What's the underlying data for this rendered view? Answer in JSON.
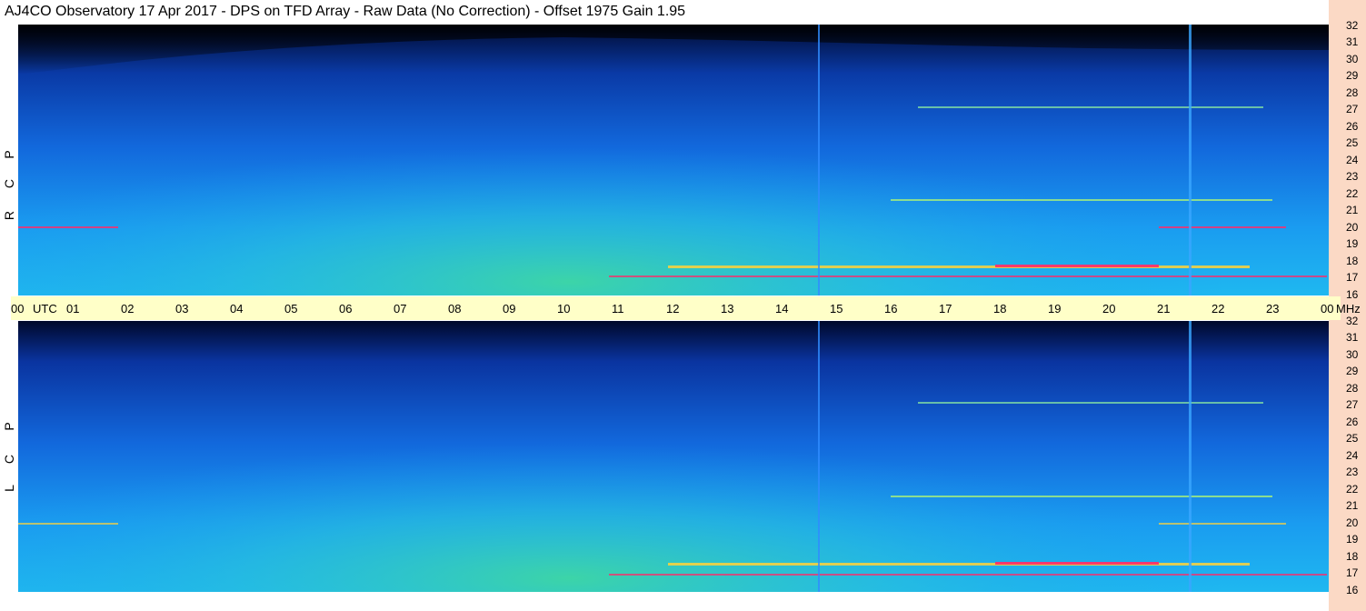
{
  "header": {
    "title": "AJ4CO Observatory  17 Apr 2017  -  DPS on TFD Array  -  Raw Data (No Correction)  -  Offset 1975  Gain 1.95"
  },
  "polarizations": {
    "top": [
      "R",
      "C",
      "P"
    ],
    "bottom": [
      "L",
      "C",
      "P"
    ]
  },
  "time_axis": {
    "labels": [
      "00",
      "01",
      "02",
      "03",
      "04",
      "05",
      "06",
      "07",
      "08",
      "09",
      "10",
      "11",
      "12",
      "13",
      "14",
      "15",
      "16",
      "17",
      "18",
      "19",
      "20",
      "21",
      "22",
      "23",
      "00"
    ],
    "utc_label": "UTC",
    "mhz_label": "MHz"
  },
  "freq_axis": {
    "labels": [
      "32",
      "31",
      "30",
      "29",
      "28",
      "27",
      "26",
      "25",
      "24",
      "23",
      "22",
      "21",
      "20",
      "19",
      "18",
      "17",
      "16"
    ]
  },
  "colors": {
    "background": "#ffffff",
    "timebar": "#ffffc8",
    "right_strip": "#fbd9c5",
    "sky_high": "#000a30",
    "sky_low": "#1a9cf0",
    "sun_glow": "#3ed6a4",
    "interference": "#ff2a6a"
  }
}
